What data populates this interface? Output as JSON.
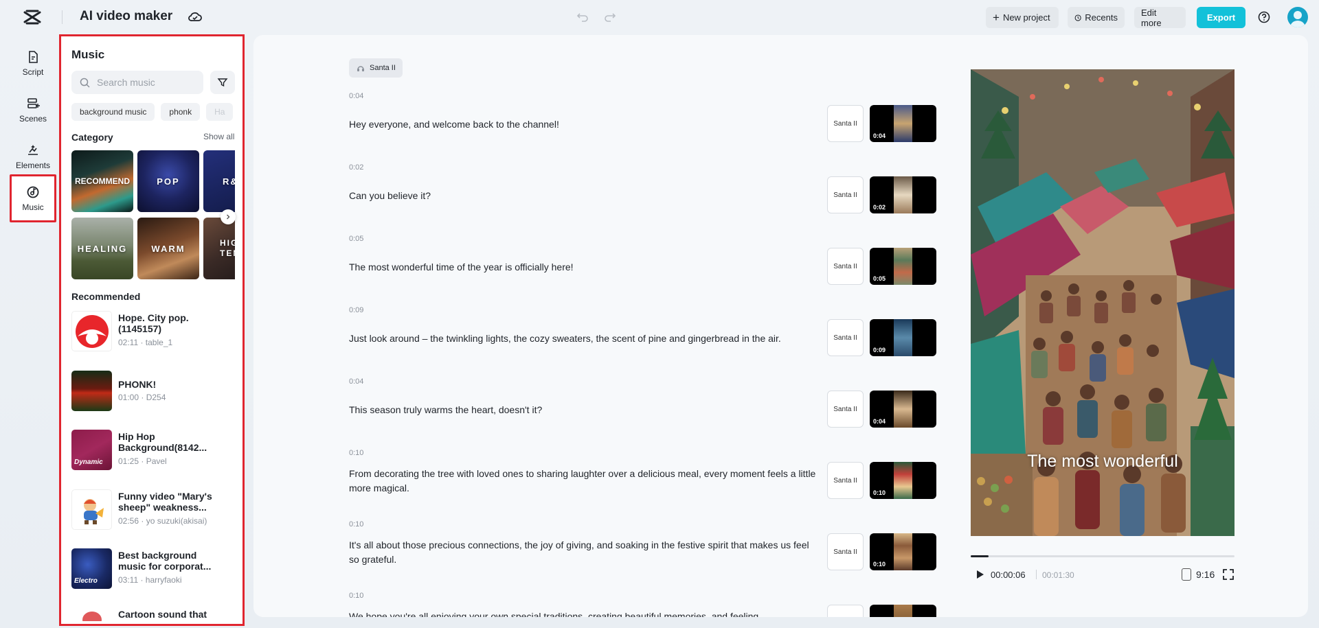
{
  "header": {
    "app_title": "AI video maker",
    "new_project": "New project",
    "recents": "Recents",
    "edit_more": "Edit more",
    "export": "Export"
  },
  "rail": [
    {
      "label": "Script",
      "icon": "script-icon"
    },
    {
      "label": "Scenes",
      "icon": "scenes-icon"
    },
    {
      "label": "Elements",
      "icon": "elements-icon"
    },
    {
      "label": "Music",
      "icon": "music-icon",
      "active": true
    }
  ],
  "music_panel": {
    "title": "Music",
    "search_placeholder": "Search music",
    "chips": [
      "background music",
      "phonk",
      "Ha"
    ],
    "category_label": "Category",
    "show_all": "Show all",
    "categories": [
      "RECOMMEND",
      "POP",
      "R&",
      "HEALING",
      "WARM",
      "HIG TEM"
    ],
    "recommended_label": "Recommended",
    "recommended": [
      {
        "title": "Hope. City pop.(1145157)",
        "meta": "02:11 · table_1",
        "thumb_label": ""
      },
      {
        "title": "PHONK!",
        "meta": "01:00 · D254",
        "thumb_label": ""
      },
      {
        "title": "Hip Hop Background(8142...",
        "meta": "01:25 · Pavel",
        "thumb_label": "Dynamic"
      },
      {
        "title": "Funny video \"Mary's sheep\" weakness...",
        "meta": "02:56 · yo suzuki(akisai)",
        "thumb_label": ""
      },
      {
        "title": "Best background music for corporat...",
        "meta": "03:11 · harryfaoki",
        "thumb_label": "Electro"
      },
      {
        "title": "Cartoon sound that",
        "meta": "",
        "thumb_label": ""
      }
    ]
  },
  "script": {
    "voice_tag": "Santa II",
    "scenes": [
      {
        "time": "0:04",
        "text": "Hey everyone, and welcome back to the channel!",
        "voice": "Santa II",
        "duration": "0:04"
      },
      {
        "time": "0:02",
        "text": "Can you believe it?",
        "voice": "Santa II",
        "duration": "0:02"
      },
      {
        "time": "0:05",
        "text": "The most wonderful time of the year is officially here!",
        "voice": "Santa II",
        "duration": "0:05"
      },
      {
        "time": "0:09",
        "text": "Just look around – the twinkling lights, the cozy sweaters, the scent of pine and gingerbread in the air.",
        "voice": "Santa II",
        "duration": "0:09"
      },
      {
        "time": "0:04",
        "text": "This season truly warms the heart, doesn't it?",
        "voice": "Santa II",
        "duration": "0:04"
      },
      {
        "time": "0:10",
        "text": "From decorating the tree with loved ones to sharing laughter over a delicious meal, every moment feels a little more magical.",
        "voice": "Santa II",
        "duration": "0:10"
      },
      {
        "time": "0:10",
        "text": "It's all about those precious connections, the joy of giving, and soaking in the festive spirit that makes us feel so grateful.",
        "voice": "Santa II",
        "duration": "0:10"
      },
      {
        "time": "0:10",
        "text": "We hope you're all enjoying your own special traditions, creating beautiful memories, and feeling",
        "voice": "",
        "duration": ""
      }
    ]
  },
  "preview": {
    "caption": "The most wonderful",
    "current_time": "00:00:06",
    "total_time": "00:01:30",
    "aspect_ratio": "9:16",
    "progress": 0.067
  }
}
